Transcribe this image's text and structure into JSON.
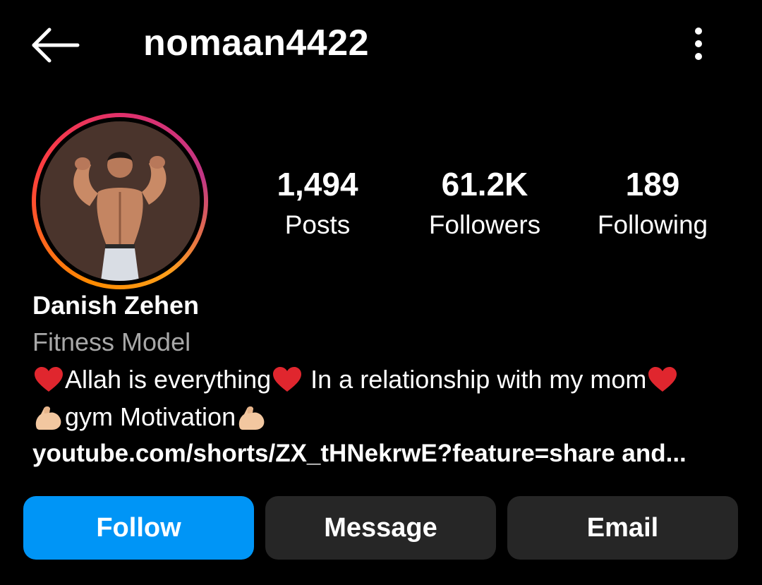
{
  "header": {
    "back_icon": "arrow-left-icon",
    "username": "nomaan4422",
    "more_icon": "more-vertical-icon"
  },
  "profile": {
    "avatar_ring_colors": [
      "#ff8a00",
      "#e1306c",
      "#c13584"
    ]
  },
  "stats": {
    "posts": {
      "value": "1,494",
      "label": "Posts"
    },
    "followers": {
      "value": "61.2K",
      "label": "Followers"
    },
    "following": {
      "value": "189",
      "label": "Following"
    }
  },
  "bio": {
    "full_name": "Danish Zehen",
    "category": "Fitness Model",
    "line1": {
      "segment1": "Allah is everything",
      "segment2": " In a relationship with my mom"
    },
    "line2": {
      "segment1": "gym Motivation"
    },
    "emoji_icons": [
      "red-heart-icon",
      "flexed-biceps-icon"
    ],
    "link": "youtube.com/shorts/ZX_tHNekrwE?feature=share and..."
  },
  "actions": {
    "follow_label": "Follow",
    "message_label": "Message",
    "email_label": "Email",
    "follow_color": "#0095f6",
    "secondary_color": "#262626"
  }
}
